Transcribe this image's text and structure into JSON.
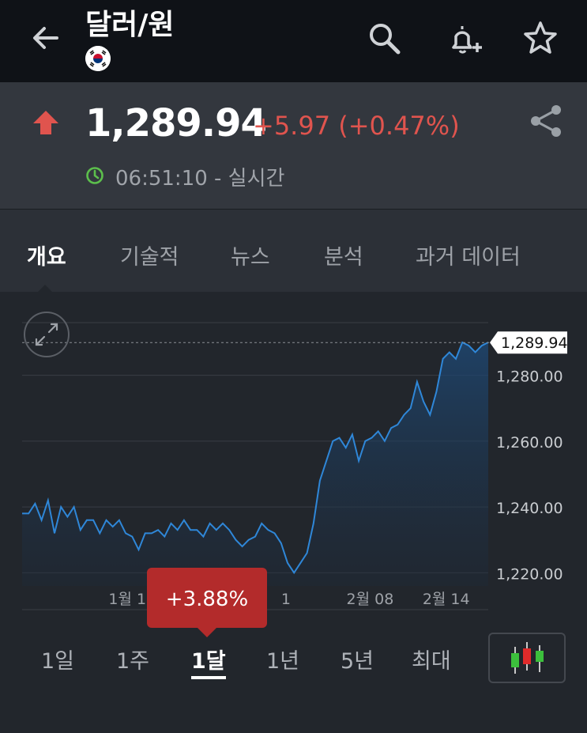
{
  "header": {
    "title": "달러/원",
    "flag": "south-korea-flag"
  },
  "quote": {
    "price": "1,289.94",
    "change": "+5.97 (+0.47%)",
    "time": "06:51:10 - 실시간",
    "up_color": "#e0544e",
    "clock_color": "#5cbf4c"
  },
  "tabs": [
    {
      "label": "개요"
    },
    {
      "label": "기술적"
    },
    {
      "label": "뉴스"
    },
    {
      "label": "분석"
    },
    {
      "label": "과거 데이터"
    }
  ],
  "periods": [
    {
      "label": "1일"
    },
    {
      "label": "1주"
    },
    {
      "label": "1달"
    },
    {
      "label": "1년"
    },
    {
      "label": "5년"
    },
    {
      "label": "최대"
    }
  ],
  "active_period": "1달",
  "tooltip": {
    "label": "+3.88%"
  },
  "chart_data": {
    "type": "area",
    "line_color": "#2f87d8",
    "ylim": [
      1216,
      1296
    ],
    "y_ticks": [
      "1,220.00",
      "1,240.00",
      "1,260.00",
      "1,280.00"
    ],
    "y_tick_values": [
      1220,
      1240,
      1260,
      1280
    ],
    "x_ticks": [
      {
        "label": "1월 19",
        "x": 6.8
      },
      {
        "label": "1",
        "x": 11.4
      },
      {
        "label": "1",
        "x": 16.3
      },
      {
        "label": "2월 08",
        "x": 21.5
      },
      {
        "label": "2월 14",
        "x": 26.2
      }
    ],
    "last_label": "1,289.94",
    "last_value": 1289.94,
    "x": [
      0.0,
      0.4,
      0.8,
      1.2,
      1.6,
      2.0,
      2.4,
      2.8,
      3.2,
      3.6,
      4.0,
      4.4,
      4.8,
      5.2,
      5.6,
      6.0,
      6.4,
      6.8,
      7.2,
      7.6,
      8.0,
      8.4,
      8.8,
      9.2,
      9.6,
      10.0,
      10.4,
      10.8,
      11.2,
      11.6,
      12.0,
      12.4,
      12.8,
      13.2,
      13.6,
      14.0,
      14.4,
      14.8,
      15.2,
      15.6,
      16.0,
      16.4,
      16.8,
      17.2,
      17.6,
      18.0,
      18.4,
      18.8,
      19.2,
      19.6,
      20.0,
      20.4,
      20.8,
      21.2,
      21.6,
      22.0,
      22.4,
      22.8,
      23.2,
      23.6,
      24.0,
      24.4,
      24.8,
      25.2,
      25.6,
      26.0,
      26.4,
      26.8,
      27.2,
      27.6,
      28.0,
      28.4,
      28.8
    ],
    "values": [
      1238,
      1238,
      1241,
      1236,
      1242,
      1232,
      1240,
      1237,
      1240,
      1233,
      1236,
      1236,
      1232,
      1236,
      1234,
      1236,
      1232,
      1231,
      1227,
      1232,
      1232,
      1233,
      1231,
      1235,
      1233,
      1236,
      1233,
      1233,
      1231,
      1235,
      1233,
      1235,
      1233,
      1230,
      1228,
      1230,
      1231,
      1235,
      1233,
      1232,
      1229,
      1223,
      1220,
      1223,
      1226,
      1235,
      1248,
      1254,
      1260,
      1261,
      1258,
      1262,
      1254,
      1260,
      1261,
      1263,
      1260,
      1264,
      1265,
      1268,
      1270,
      1278,
      1272,
      1268,
      1275,
      1285,
      1287,
      1285,
      1290,
      1289,
      1287,
      1289,
      1290
    ]
  }
}
